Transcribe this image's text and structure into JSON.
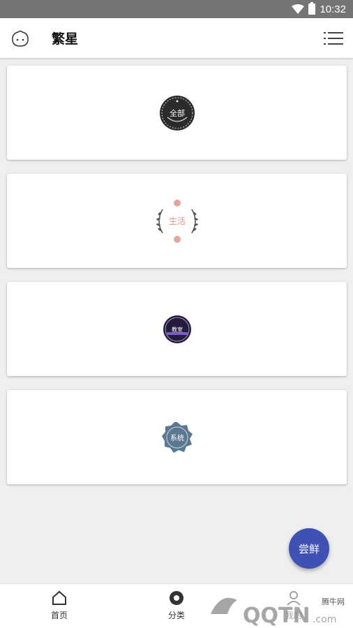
{
  "status_bar": {
    "time": "10:32"
  },
  "app_bar": {
    "title": "繁星"
  },
  "categories": [
    {
      "label": "全部",
      "style": "dark-wreath"
    },
    {
      "label": "生活",
      "style": "floral-wreath"
    },
    {
      "label": "教室",
      "style": "purple-seal"
    },
    {
      "label": "系统",
      "style": "blue-badge"
    }
  ],
  "fab": {
    "label": "尝鲜"
  },
  "bottom_nav": {
    "items": [
      {
        "label": "首页",
        "icon": "home-icon"
      },
      {
        "label": "分类",
        "icon": "category-icon"
      },
      {
        "label": "我的",
        "icon": "profile-icon"
      }
    ]
  },
  "watermark": {
    "cn": "腾牛网"
  },
  "colors": {
    "status_bar": "#757575",
    "fab": "#3f51b5",
    "background": "#efefef"
  }
}
